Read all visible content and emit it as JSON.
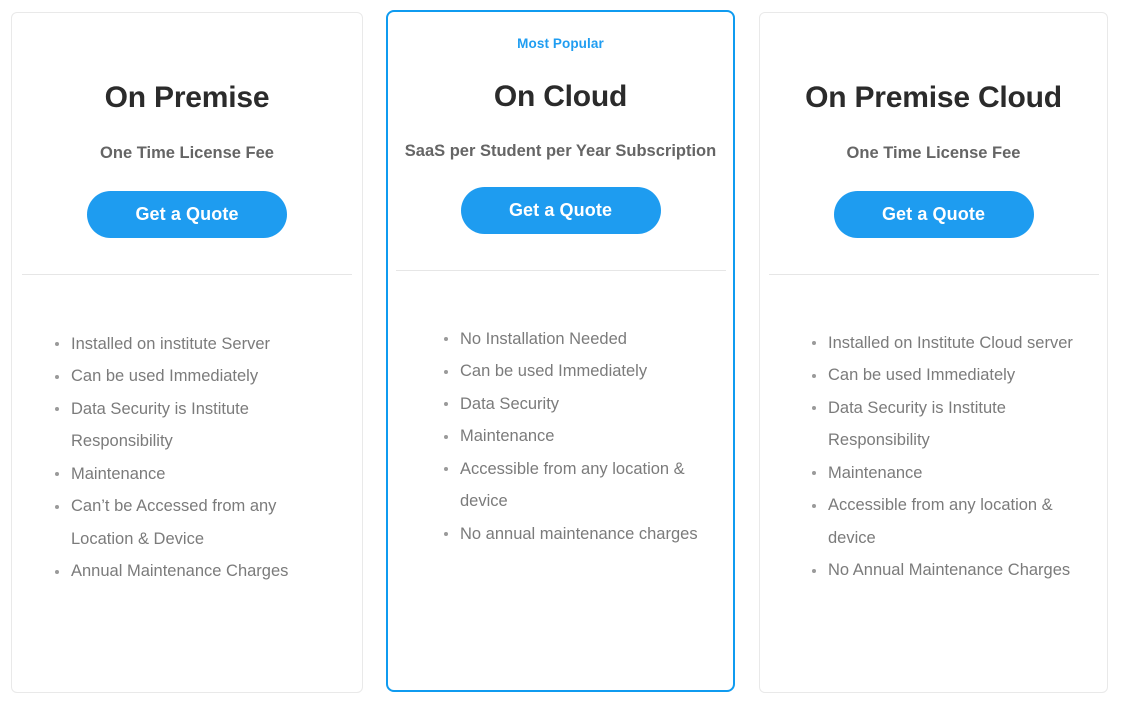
{
  "plans": [
    {
      "id": "on-premise",
      "badge": null,
      "title": "On Premise",
      "subtitle": "One Time License Fee",
      "cta_label": "Get a Quote",
      "highlighted": false,
      "features": [
        "Installed on institute Server",
        "Can be used Immediately",
        "Data Security is Institute Responsibility",
        "Maintenance",
        "Can’t be Accessed from any Location & Device",
        "Annual Maintenance Charges"
      ]
    },
    {
      "id": "on-cloud",
      "badge": "Most Popular",
      "title": "On Cloud",
      "subtitle": "SaaS per Student per Year Subscription",
      "cta_label": "Get a Quote",
      "highlighted": true,
      "features": [
        "No Installation Needed",
        "Can be used Immediately",
        "Data Security",
        "Maintenance",
        "Accessible from any location & device",
        "No annual maintenance charges"
      ]
    },
    {
      "id": "on-premise-cloud",
      "badge": null,
      "title": "On Premise Cloud",
      "subtitle": "One Time License Fee",
      "cta_label": "Get a Quote",
      "highlighted": false,
      "features": [
        "Installed on Institute Cloud server",
        "Can be used Immediately",
        "Data Security is Institute Responsibility",
        "Maintenance",
        "Accessible from any location & device",
        "No Annual Maintenance Charges"
      ]
    }
  ],
  "colors": {
    "accent": "#1e9cf0",
    "highlight_border": "#0f9bf0",
    "card_border": "#e9e9e9",
    "title": "#2b2b2b",
    "subtitle": "#656565",
    "feature_text": "#7b7b7b",
    "divider": "#e6e6e6"
  }
}
